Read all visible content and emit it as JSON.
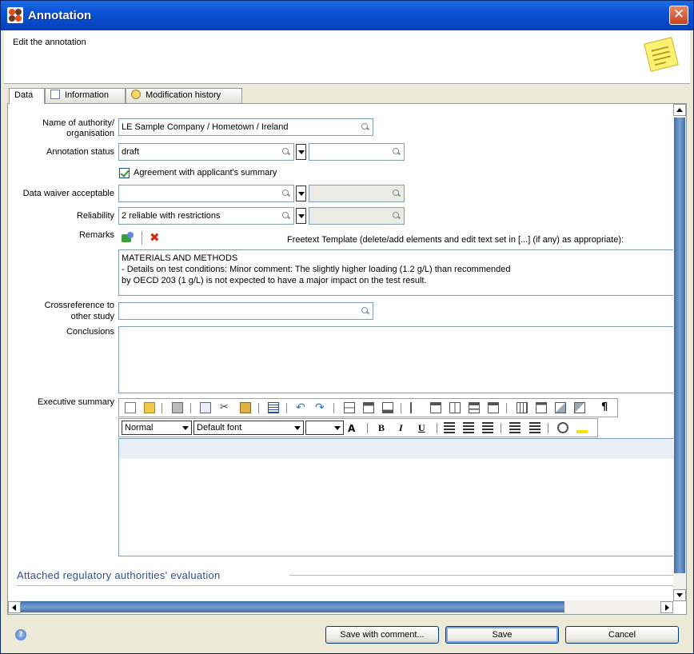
{
  "window": {
    "title": "Annotation",
    "subtitle": "Edit the annotation"
  },
  "tabs": [
    {
      "label": "Data"
    },
    {
      "label": "Information"
    },
    {
      "label": "Modification history"
    }
  ],
  "form": {
    "authority_label": "Name of authority/ organisation",
    "authority_label_l1": "Name of authority/",
    "authority_label_l2": "organisation",
    "authority_value": "LE Sample Company / Hometown / Ireland",
    "status_label": "Annotation status",
    "status_value": "draft",
    "agreement_label": "Agreement with applicant's summary",
    "agreement_checked": true,
    "waiver_label": "Data waiver acceptable",
    "waiver_value": "",
    "reliability_label": "Reliability",
    "reliability_value": "2 reliable with restrictions",
    "remarks_label": "Remarks",
    "freetext_hint": "Freetext Template (delete/add elements and edit text set in [...] (if any) as appropriate):",
    "remarks_lines": [
      "MATERIALS AND METHODS",
      "- Details on test conditions: Minor comment: The slightly higher loading (1.2 g/L) than recommended",
      "by OECD 203 (1 g/L) is not expected to have a major impact on the test result."
    ],
    "crossref_label_l1": "Crossreference to",
    "crossref_label_l2": "other study",
    "crossref_value": "",
    "conclusions_label": "Conclusions",
    "exec_label": "Executive summary",
    "style_value": "Normal",
    "font_value": "Default font",
    "size_value": "",
    "bold": "B",
    "italic": "I",
    "underline": "U",
    "pilcrow": "¶"
  },
  "section": {
    "attached_title": "Attached regulatory authorities' evaluation"
  },
  "buttons": {
    "save_comment": "Save with comment...",
    "save": "Save",
    "cancel": "Cancel"
  },
  "colors": {
    "accent": "#0A52D6",
    "close": "#C6421E",
    "section": "#2F4F8F"
  }
}
